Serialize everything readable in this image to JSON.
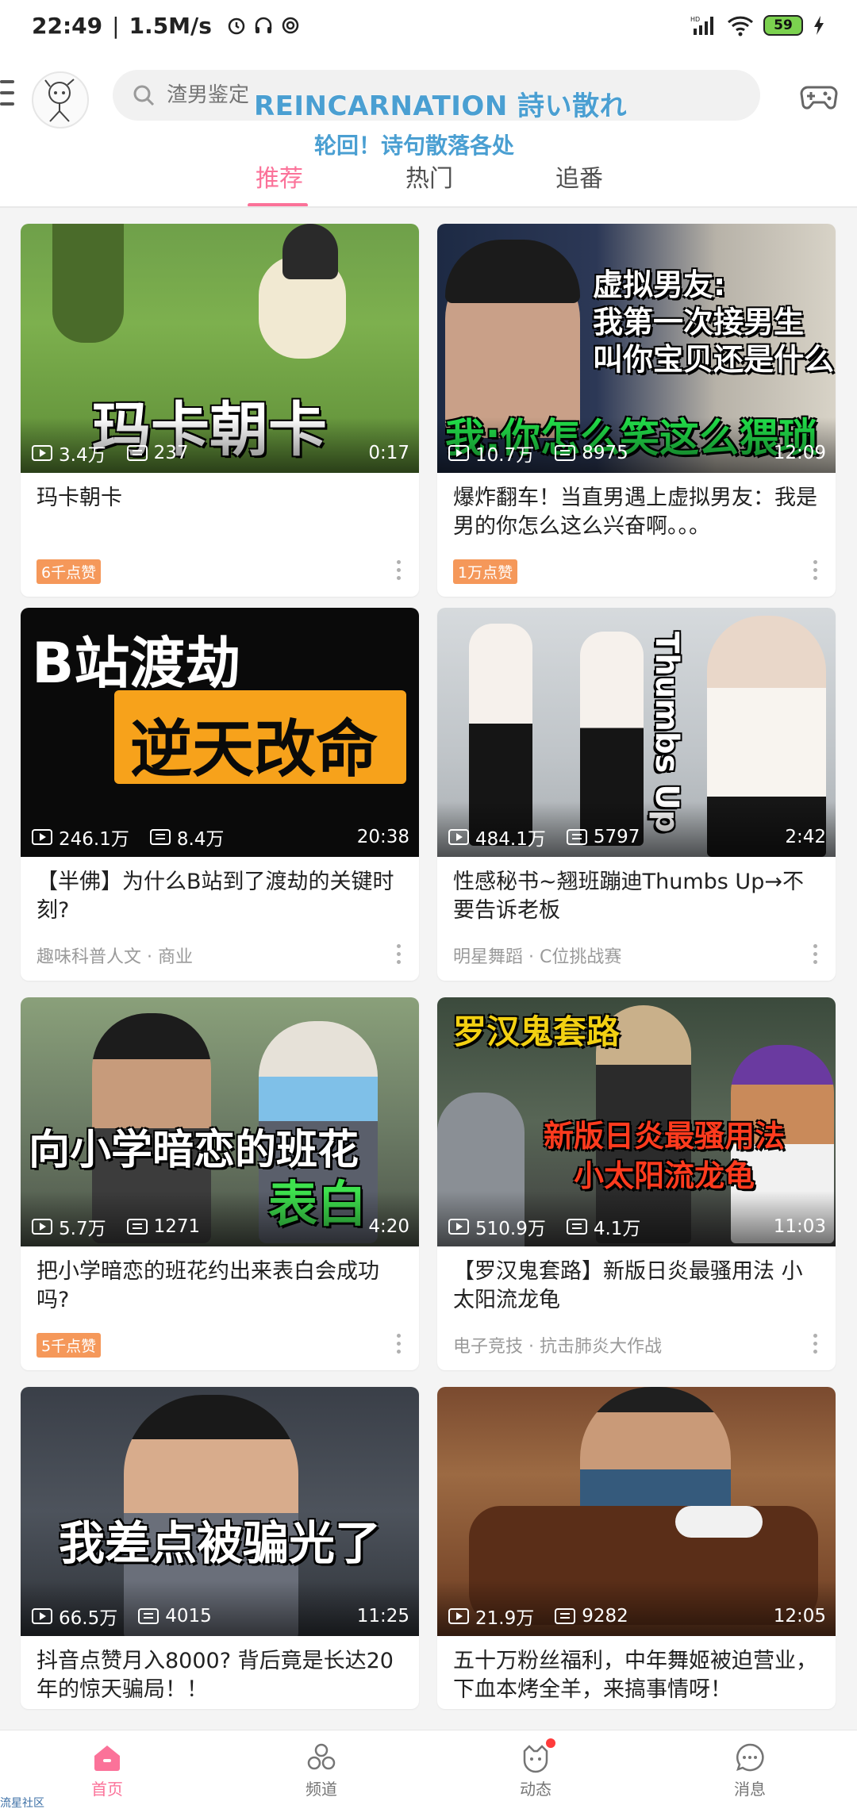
{
  "status_bar": {
    "time": "22:49",
    "speed": "1.5M/s",
    "battery": "59",
    "icons": [
      "alarm-icon",
      "headphones-icon",
      "sync-icon",
      "signal-icon",
      "wifi-icon",
      "battery-icon",
      "charging-icon"
    ]
  },
  "header": {
    "search_placeholder": "渣男鉴定",
    "overlay_en": "REINCARNATION 詩い散れ",
    "overlay_cn": "轮回！诗句散落各处",
    "tabs": [
      {
        "label": "推荐",
        "active": true
      },
      {
        "label": "热门",
        "active": false
      },
      {
        "label": "追番",
        "active": false
      }
    ]
  },
  "cards": [
    {
      "thumb_caption": "玛卡朝卡",
      "views": "3.4万",
      "danmaku": "237",
      "duration": "0:17",
      "title": "玛卡朝卡",
      "badge": "6千点赞",
      "tag": ""
    },
    {
      "thumb_caption": "虚拟男友:\n我第一次接男生\n叫你宝贝还是什么",
      "thumb_caption2": "我:你怎么笑这么猥琐",
      "views": "10.7万",
      "danmaku": "8975",
      "duration": "12:09",
      "title": "爆炸翻车！当直男遇上虚拟男友：我是男的你怎么这么兴奋啊。。。",
      "badge": "1万点赞",
      "tag": ""
    },
    {
      "thumb_caption": "B站渡劫",
      "thumb_caption2": "逆天改命",
      "views": "246.1万",
      "danmaku": "8.4万",
      "duration": "20:38",
      "title": "【半佛】为什么B站到了渡劫的关键时刻?",
      "badge": "",
      "tag": "趣味科普人文 · 商业"
    },
    {
      "thumb_caption": "Thumbs Up",
      "views": "484.1万",
      "danmaku": "5797",
      "duration": "2:42",
      "title": "性感秘书~翘班蹦迪Thumbs Up→不要告诉老板",
      "badge": "",
      "tag": "明星舞蹈 · C位挑战赛"
    },
    {
      "thumb_caption": "向小学暗恋的班花",
      "thumb_caption2": "表白",
      "views": "5.7万",
      "danmaku": "1271",
      "duration": "4:20",
      "title": "把小学暗恋的班花约出来表白会成功吗?",
      "badge": "5千点赞",
      "tag": ""
    },
    {
      "thumb_caption": "罗汉鬼套路",
      "thumb_caption2": "新版日炎最骚用法\n小太阳流龙龟",
      "views": "510.9万",
      "danmaku": "4.1万",
      "duration": "11:03",
      "title": "【罗汉鬼套路】新版日炎最骚用法 小太阳流龙龟",
      "badge": "",
      "tag": "电子竞技 · 抗击肺炎大作战"
    },
    {
      "thumb_caption": "我差点被骗光了",
      "views": "66.5万",
      "danmaku": "4015",
      "duration": "11:25",
      "title": "抖音点赞月入8000? 背后竟是长达20年的惊天骗局！！",
      "badge": "",
      "tag": ""
    },
    {
      "thumb_caption": "",
      "views": "21.9万",
      "danmaku": "9282",
      "duration": "12:05",
      "title": "五十万粉丝福利，中年舞姬被迫营业，下血本烤全羊，来搞事情呀！",
      "badge": "",
      "tag": ""
    }
  ],
  "bottom_nav": [
    {
      "label": "首页",
      "icon": "home-icon",
      "active": true
    },
    {
      "label": "频道",
      "icon": "channel-icon",
      "active": false
    },
    {
      "label": "动态",
      "icon": "dynamic-icon",
      "active": false
    },
    {
      "label": "消息",
      "icon": "message-icon",
      "active": false
    }
  ],
  "watermark": "流星社区",
  "colors": {
    "accent": "#fb7299",
    "badge": "#f5985a",
    "text": "#212121",
    "muted": "#9a9a9a"
  }
}
